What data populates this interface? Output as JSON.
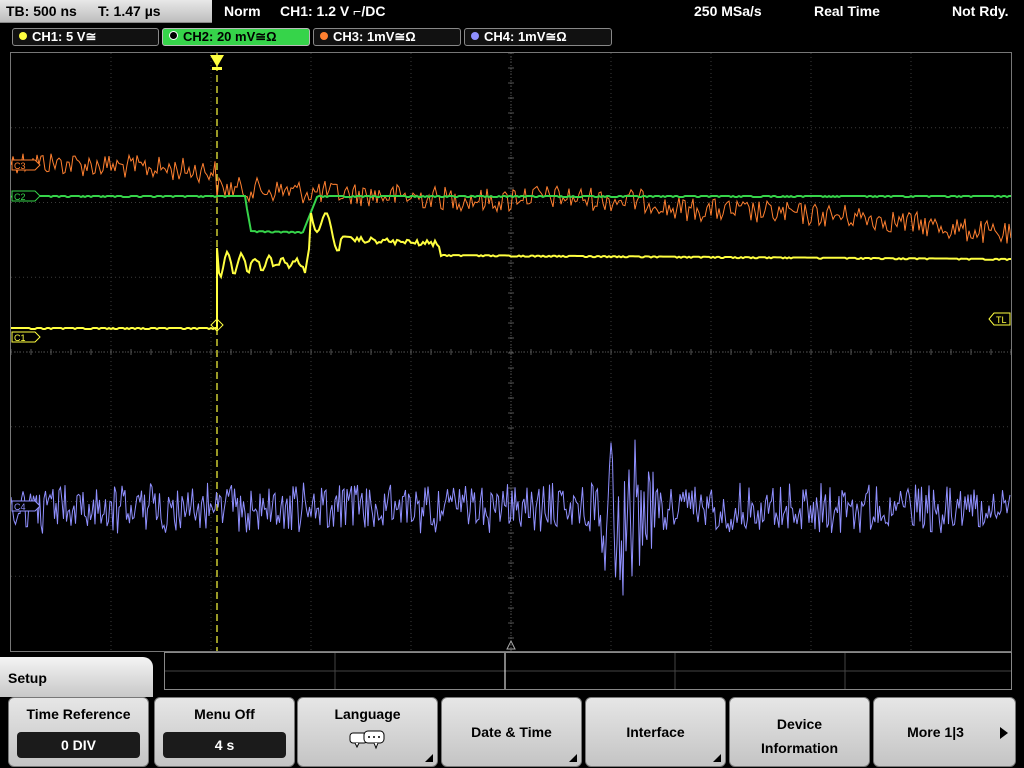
{
  "topbar": {
    "timebase": "TB: 500 ns",
    "trigger_time": "T: 1.47 µs",
    "mode": "Norm",
    "trigger_source": "CH1: 1.2 V ⌐/DC",
    "sample_rate": "250 MSa/s",
    "acquisition": "Real Time",
    "status": "Not Rdy."
  },
  "channels": [
    {
      "label": "CH1: 5 V≅",
      "color": "#ffff40"
    },
    {
      "label": "CH2: 20 mV≅Ω",
      "color": "#36d44a"
    },
    {
      "label": "CH3: 1mV≅Ω",
      "color": "#ff8030"
    },
    {
      "label": "CH4: 1mV≅Ω",
      "color": "#9090ff"
    }
  ],
  "markers": {
    "c1": "C1",
    "c2": "C2",
    "c3": "C3",
    "c4": "C4",
    "trigger_level": "TL"
  },
  "menu": {
    "title": "Setup"
  },
  "softkeys": {
    "time_reference": {
      "label": "Time Reference",
      "value": "0 DIV"
    },
    "menu_off": {
      "label": "Menu Off",
      "value": "4 s"
    },
    "language": {
      "label": "Language",
      "icon": "speech-bubble-icon"
    },
    "date_time": {
      "label": "Date & Time"
    },
    "interface": {
      "label": "Interface"
    },
    "device_info": {
      "line1": "Device",
      "line2": "Information"
    },
    "more": {
      "label": "More 1|3"
    }
  }
}
